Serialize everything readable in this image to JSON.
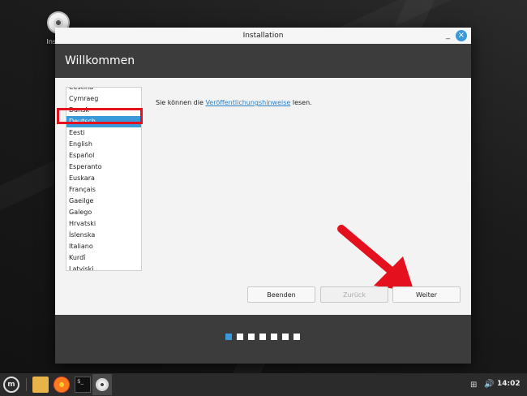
{
  "desktop": {
    "icon_label": "Installa"
  },
  "window": {
    "title": "Installation",
    "minimize": "_",
    "close": "×"
  },
  "header": {
    "title": "Willkommen"
  },
  "languages": [
    "Čeština",
    "Cymraeg",
    "Dansk",
    "Deutsch",
    "Eesti",
    "English",
    "Español",
    "Esperanto",
    "Euskara",
    "Français",
    "Gaeilge",
    "Galego",
    "Hrvatski",
    "Íslenska",
    "Italiano",
    "Kurdî",
    "Latviski"
  ],
  "selected_language": "Deutsch",
  "release": {
    "prefix": "Sie können die ",
    "link": "Veröffentlichungshinweise",
    "suffix": " lesen."
  },
  "buttons": {
    "quit": "Beenden",
    "back": "Zurück",
    "next": "Weiter"
  },
  "steps": {
    "total": 7,
    "current": 1
  },
  "taskbar": {
    "terminal_prompt": "$_",
    "clock": "14:02"
  },
  "colors": {
    "accent": "#3a9ad9",
    "annotation": "#e5101d",
    "header_bg": "#3c3c3c"
  }
}
